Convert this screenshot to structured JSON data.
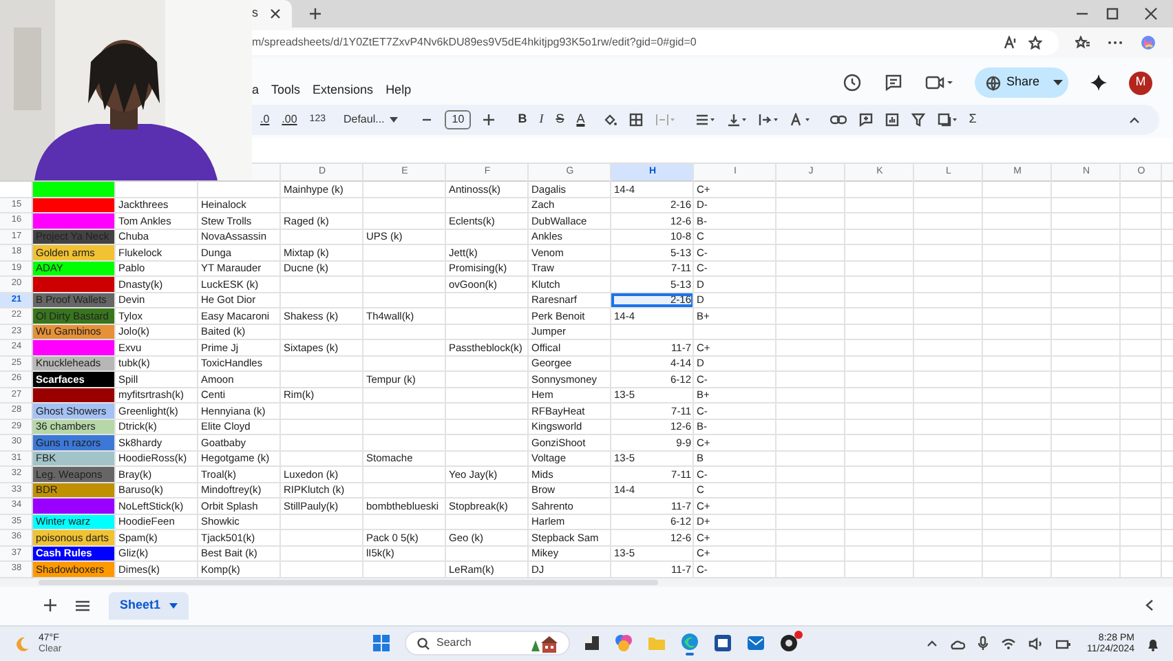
{
  "browser": {
    "tab_title": "s",
    "url": "m/spreadsheets/d/1Y0ZtET7ZxvP4Nv6kDU89es9V5dE4hkitjpg93K5o1rw/edit?gid=0#gid=0"
  },
  "menu": [
    "a",
    "Tools",
    "Extensions",
    "Help"
  ],
  "share_button": "Share",
  "avatar": "M",
  "toolbar": {
    "decimal_decrease": ".0",
    "decimal_increase": ".00",
    "number_format": "123",
    "font": "Defaul...",
    "font_size": "10",
    "format_buttons": [
      "B",
      "I",
      "S",
      "A"
    ],
    "functions": "Σ"
  },
  "columns": [
    {
      "label": "D",
      "selected": false
    },
    {
      "label": "E",
      "selected": false
    },
    {
      "label": "F",
      "selected": false
    },
    {
      "label": "G",
      "selected": false
    },
    {
      "label": "H",
      "selected": true
    },
    {
      "label": "I",
      "selected": false
    },
    {
      "label": "J",
      "selected": false
    },
    {
      "label": "K",
      "selected": false
    },
    {
      "label": "L",
      "selected": false
    },
    {
      "label": "M",
      "selected": false
    },
    {
      "label": "N",
      "selected": false
    },
    {
      "label": "O",
      "selected": false
    }
  ],
  "rows": [
    {
      "selected": false,
      "color": "#00ff00",
      "cells": {
        "D": "Mainhype (k)",
        "F": "Antinoss(k)",
        "G": "Dagalis",
        "H": "14-4",
        "I": "C+"
      },
      "record_is_text": true
    },
    {
      "number": "15",
      "selected": false,
      "color": "#ff0000",
      "cells": {
        "B": "Jackthrees",
        "C": "Heinalock",
        "G": "Zach",
        "H": "2-16",
        "I": "D-"
      },
      "record_is_text": false
    },
    {
      "number": "16",
      "selected": false,
      "color": "#ff00ff",
      "cells": {
        "B": "Tom Ankles",
        "C": "Stew Trolls",
        "D": "Raged (k)",
        "F": "Eclents(k)",
        "G": "DubWallace",
        "H": "12-6",
        "I": "B-"
      },
      "record_is_text": false
    },
    {
      "number": "17",
      "selected": false,
      "inverted": false,
      "color": "#434343",
      "team": "Project Ya Neck",
      "cells": {
        "B": "Chuba",
        "C": "NovaAssassin",
        "E": "UPS (k)",
        "G": "Ankles",
        "H": "10-8",
        "I": "C"
      },
      "record_is_text": false
    },
    {
      "number": "18",
      "selected": false,
      "inverted": false,
      "color": "#f1c232",
      "team": "Golden arms",
      "cells": {
        "B": "Flukelock",
        "C": "Dunga",
        "D": "Mixtap (k)",
        "F": "Jett(k)",
        "G": "Venom",
        "H": "5-13",
        "I": "C-"
      },
      "record_is_text": false
    },
    {
      "number": "19",
      "selected": false,
      "inverted": false,
      "color": "#00ff00",
      "team": "ADAY",
      "cells": {
        "B": "Pablo",
        "C": "YT Marauder",
        "D": "Ducne (k)",
        "F": "Promising(k)",
        "G": "Traw",
        "H": "7-11",
        "I": "C-"
      },
      "record_is_text": false
    },
    {
      "number": "20",
      "selected": false,
      "color": "#cc0000",
      "cells": {
        "B": "Dnasty(k)",
        "C": "LuckESK (k)",
        "F": "ovGoon(k)",
        "G": "Klutch",
        "H": "5-13",
        "I": "D"
      },
      "record_is_text": false
    },
    {
      "number": "21",
      "selected": true,
      "inverted": false,
      "color": "#666666",
      "team": "B Proof Wallets",
      "cells": {
        "B": "Devin",
        "C": "He Got Dior",
        "G": "Raresnarf",
        "H": "2-16",
        "I": "D"
      },
      "record_is_text": false
    },
    {
      "number": "22",
      "selected": false,
      "inverted": false,
      "color": "#38761d",
      "team": "Ol Dirty Bastard",
      "cells": {
        "B": "Tylox",
        "C": "Easy Macaroni",
        "D": "Shakess (k)",
        "E": "Th4wall(k)",
        "G": "Perk Benoit",
        "H": "14-4",
        "I": "B+"
      },
      "record_is_text": true
    },
    {
      "number": "23",
      "selected": false,
      "inverted": false,
      "color": "#e69138",
      "team": "Wu Gambinos",
      "cells": {
        "B": "Jolo(k)",
        "C": "Baited (k)",
        "G": "Jumper"
      }
    },
    {
      "number": "24",
      "selected": false,
      "color": "#ff00ff",
      "cells": {
        "B": "Exvu",
        "C": "Prime Jj",
        "D": "Sixtapes (k)",
        "F": "Passtheblock(k)",
        "G": "Offical",
        "H": "11-7",
        "I": "C+"
      },
      "record_is_text": false
    },
    {
      "number": "25",
      "selected": false,
      "inverted": false,
      "color": "#b7b7b7",
      "team": "Knuckleheads",
      "cells": {
        "B": "tubk(k)",
        "C": "ToxicHandles",
        "G": "Georgee",
        "H": "4-14",
        "I": "D"
      },
      "record_is_text": false
    },
    {
      "number": "26",
      "selected": false,
      "inverted": true,
      "color": "#000000",
      "team": "Scarfaces",
      "cells": {
        "B": "Spill",
        "C": "Amoon",
        "E": "Tempur (k)",
        "G": "Sonnysmoney",
        "H": "6-12",
        "I": "C-"
      },
      "record_is_text": false
    },
    {
      "number": "27",
      "selected": false,
      "color": "#990000",
      "cells": {
        "B": "myfitsrtrash(k)",
        "C": "Centi",
        "D": "Rim(k)",
        "G": "Hem",
        "H": "13-5",
        "I": "B+"
      },
      "record_is_text": true
    },
    {
      "number": "28",
      "selected": false,
      "inverted": false,
      "color": "#a4c2f4",
      "team": "Ghost Showers",
      "cells": {
        "B": "Greenlight(k)",
        "C": "Hennyiana (k)",
        "G": "RFBayHeat",
        "H": "7-11",
        "I": "C-"
      },
      "record_is_text": false
    },
    {
      "number": "29",
      "selected": false,
      "inverted": false,
      "color": "#b6d7a8",
      "team": "36 chambers",
      "cells": {
        "B": "Dtrick(k)",
        "C": "Elite Cloyd",
        "G": "Kingsworld",
        "H": "12-6",
        "I": "B-"
      },
      "record_is_text": false
    },
    {
      "number": "30",
      "selected": false,
      "inverted": false,
      "color": "#3c78d8",
      "team": "Guns n razors",
      "cells": {
        "B": "Sk8hardy",
        "C": "Goatbaby",
        "G": "GonziShoot",
        "H": "9-9",
        "I": "C+"
      },
      "record_is_text": false
    },
    {
      "number": "31",
      "selected": false,
      "inverted": false,
      "color": "#a2c4c9",
      "team": "FBK",
      "cells": {
        "B": "HoodieRoss(k)",
        "C": "Hegotgame (k)",
        "E": "Stomache",
        "G": "Voltage",
        "H": "13-5",
        "I": "B"
      },
      "record_is_text": true
    },
    {
      "number": "32",
      "selected": false,
      "inverted": false,
      "color": "#666666",
      "team": "Leg. Weapons",
      "cells": {
        "B": "Bray(k)",
        "C": "Troal(k)",
        "D": "Luxedon (k)",
        "F": "Yeo Jay(k)",
        "G": "Mids",
        "H": "7-11",
        "I": "C-"
      },
      "record_is_text": false
    },
    {
      "number": "33",
      "selected": false,
      "inverted": false,
      "color": "#bf9000",
      "team": "BDR",
      "cells": {
        "B": "Baruso(k)",
        "C": "Mindoftrey(k)",
        "D": "RIPKlutch (k)",
        "G": "Brow",
        "H": "14-4",
        "I": "C"
      },
      "record_is_text": true
    },
    {
      "number": "34",
      "selected": false,
      "color": "#9900ff",
      "cells": {
        "B": "NoLeftStick(k)",
        "C": "Orbit Splash",
        "D": "StillPauly(k)",
        "E": "bombtheblueski",
        "F": "Stopbreak(k)",
        "G": "Sahrento",
        "H": "11-7",
        "I": "C+"
      },
      "record_is_text": false
    },
    {
      "number": "35",
      "selected": false,
      "inverted": false,
      "color": "#00ffff",
      "team": "Winter warz",
      "cells": {
        "B": "HoodieFeen",
        "C": "Showkic",
        "G": "Harlem",
        "H": "6-12",
        "I": "D+"
      },
      "record_is_text": false
    },
    {
      "number": "36",
      "selected": false,
      "inverted": false,
      "color": "#f1c232",
      "team": "poisonous darts",
      "cells": {
        "B": "Spam(k)",
        "C": "Tjack501(k)",
        "E": "Pack 0 5(k)",
        "F": "Geo (k)",
        "G": "Stepback Sam",
        "H": "12-6",
        "I": "C+"
      },
      "record_is_text": false
    },
    {
      "number": "37",
      "selected": false,
      "inverted": true,
      "color": "#0000ff",
      "team": "Cash Rules",
      "cells": {
        "B": "Gliz(k)",
        "C": "Best Bait (k)",
        "E": "lI5k(k)",
        "G": "Mikey",
        "H": "13-5",
        "I": "C+"
      },
      "record_is_text": true
    },
    {
      "number": "38",
      "selected": false,
      "inverted": false,
      "color": "#ff9900",
      "team": "Shadowboxers",
      "cells": {
        "B": "Dimes(k)",
        "C": "Komp(k)",
        "F": "LeRam(k)",
        "G": "DJ",
        "H": "11-7",
        "I": "C-"
      },
      "record_is_text": false
    }
  ],
  "sheets": [
    {
      "label": "Sheet1",
      "selected": true
    }
  ],
  "taskbar": {
    "temperature": "47°F",
    "weather": "Clear",
    "search_placeholder": "Search",
    "time": "8:28 PM",
    "date": "11/24/2024"
  }
}
